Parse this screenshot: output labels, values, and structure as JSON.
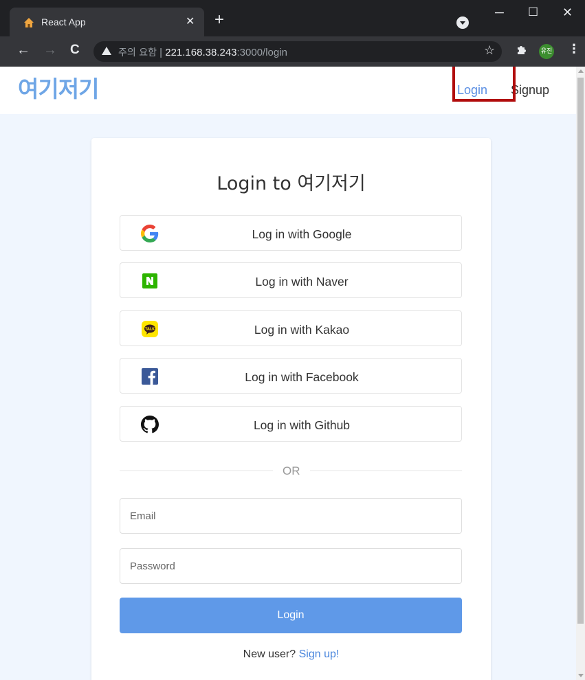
{
  "browser": {
    "tab_title": "React App",
    "tab_close": "✕",
    "new_tab": "+",
    "security_label": "주의 요함",
    "separator": "|",
    "url_host": "221.168.38.243",
    "url_rest": ":3000/login",
    "profile_initials": "유진"
  },
  "header": {
    "logo": "여기저기",
    "nav_login": "Login",
    "nav_signup": "Signup"
  },
  "card": {
    "title": "Login to 여기저기",
    "social_buttons": [
      {
        "label": "Log in with Google",
        "icon": "google-icon"
      },
      {
        "label": "Log in with Naver",
        "icon": "naver-icon"
      },
      {
        "label": "Log in with Kakao",
        "icon": "kakao-icon"
      },
      {
        "label": "Log in with Facebook",
        "icon": "facebook-icon"
      },
      {
        "label": "Log in with Github",
        "icon": "github-icon"
      }
    ],
    "or_text": "OR",
    "email_placeholder": "Email",
    "password_placeholder": "Password",
    "login_button": "Login",
    "new_user_text": "New user?",
    "signup_link": "Sign up!"
  },
  "colors": {
    "accent": "#5f99e8",
    "logo": "#6fa6e6",
    "page_bg": "#f0f6fe",
    "highlight": "#b10c0c"
  }
}
